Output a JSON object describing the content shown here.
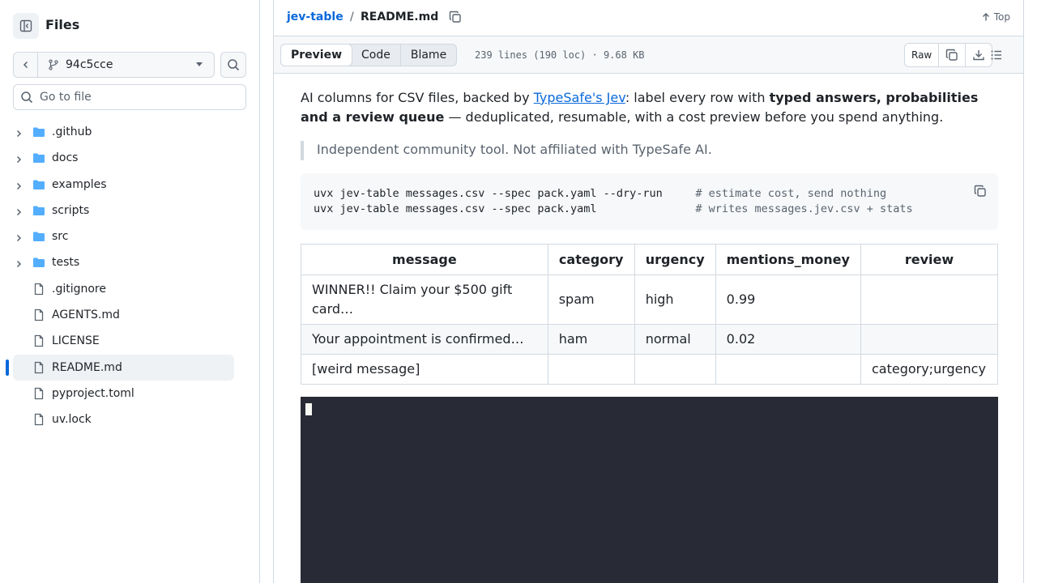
{
  "sidebar": {
    "title": "Files",
    "branch": "94c5cce",
    "goto_placeholder": "Go to file",
    "items": [
      {
        "label": ".github",
        "type": "folder"
      },
      {
        "label": "docs",
        "type": "folder"
      },
      {
        "label": "examples",
        "type": "folder"
      },
      {
        "label": "scripts",
        "type": "folder"
      },
      {
        "label": "src",
        "type": "folder"
      },
      {
        "label": "tests",
        "type": "folder"
      },
      {
        "label": ".gitignore",
        "type": "file"
      },
      {
        "label": "AGENTS.md",
        "type": "file"
      },
      {
        "label": "LICENSE",
        "type": "file"
      },
      {
        "label": "README.md",
        "type": "file",
        "selected": true
      },
      {
        "label": "pyproject.toml",
        "type": "file"
      },
      {
        "label": "uv.lock",
        "type": "file"
      }
    ]
  },
  "header": {
    "repo": "jev-table",
    "separator": "/",
    "file": "README.md",
    "top_label": "Top"
  },
  "filebar": {
    "tabs": [
      "Preview",
      "Code",
      "Blame"
    ],
    "meta": "239 lines (190 loc) · 9.68 KB",
    "raw_label": "Raw"
  },
  "readme": {
    "lead_pre": "AI columns for CSV files, backed by ",
    "lead_link": "TypeSafe's Jev",
    "lead_mid": ": label every row with ",
    "lead_bold": "typed answers, probabilities and a review queue",
    "lead_post": " — deduplicated, resumable, with a cost preview before you spend anything.",
    "quote": "Independent community tool. Not affiliated with TypeSafe AI.",
    "code": [
      {
        "cmd": "uvx jev-table messages.csv --spec pack.yaml --dry-run     ",
        "comment": "# estimate cost, send nothing"
      },
      {
        "cmd": "uvx jev-table messages.csv --spec pack.yaml               ",
        "comment": "# writes messages.jev.csv + stats"
      }
    ],
    "table": {
      "headers": [
        "message",
        "category",
        "urgency",
        "mentions_money",
        "review"
      ],
      "rows": [
        [
          "WINNER!! Claim your $500 gift card…",
          "spam",
          "high",
          "0.99",
          ""
        ],
        [
          "Your appointment is confirmed…",
          "ham",
          "normal",
          "0.02",
          ""
        ],
        [
          "[weird message]",
          "",
          "",
          "",
          "category;urgency"
        ]
      ]
    }
  },
  "colors": {
    "accent": "#0969da",
    "border": "#d1d9e0",
    "terminal_bg": "#282a36",
    "folder": "#54aeff"
  }
}
